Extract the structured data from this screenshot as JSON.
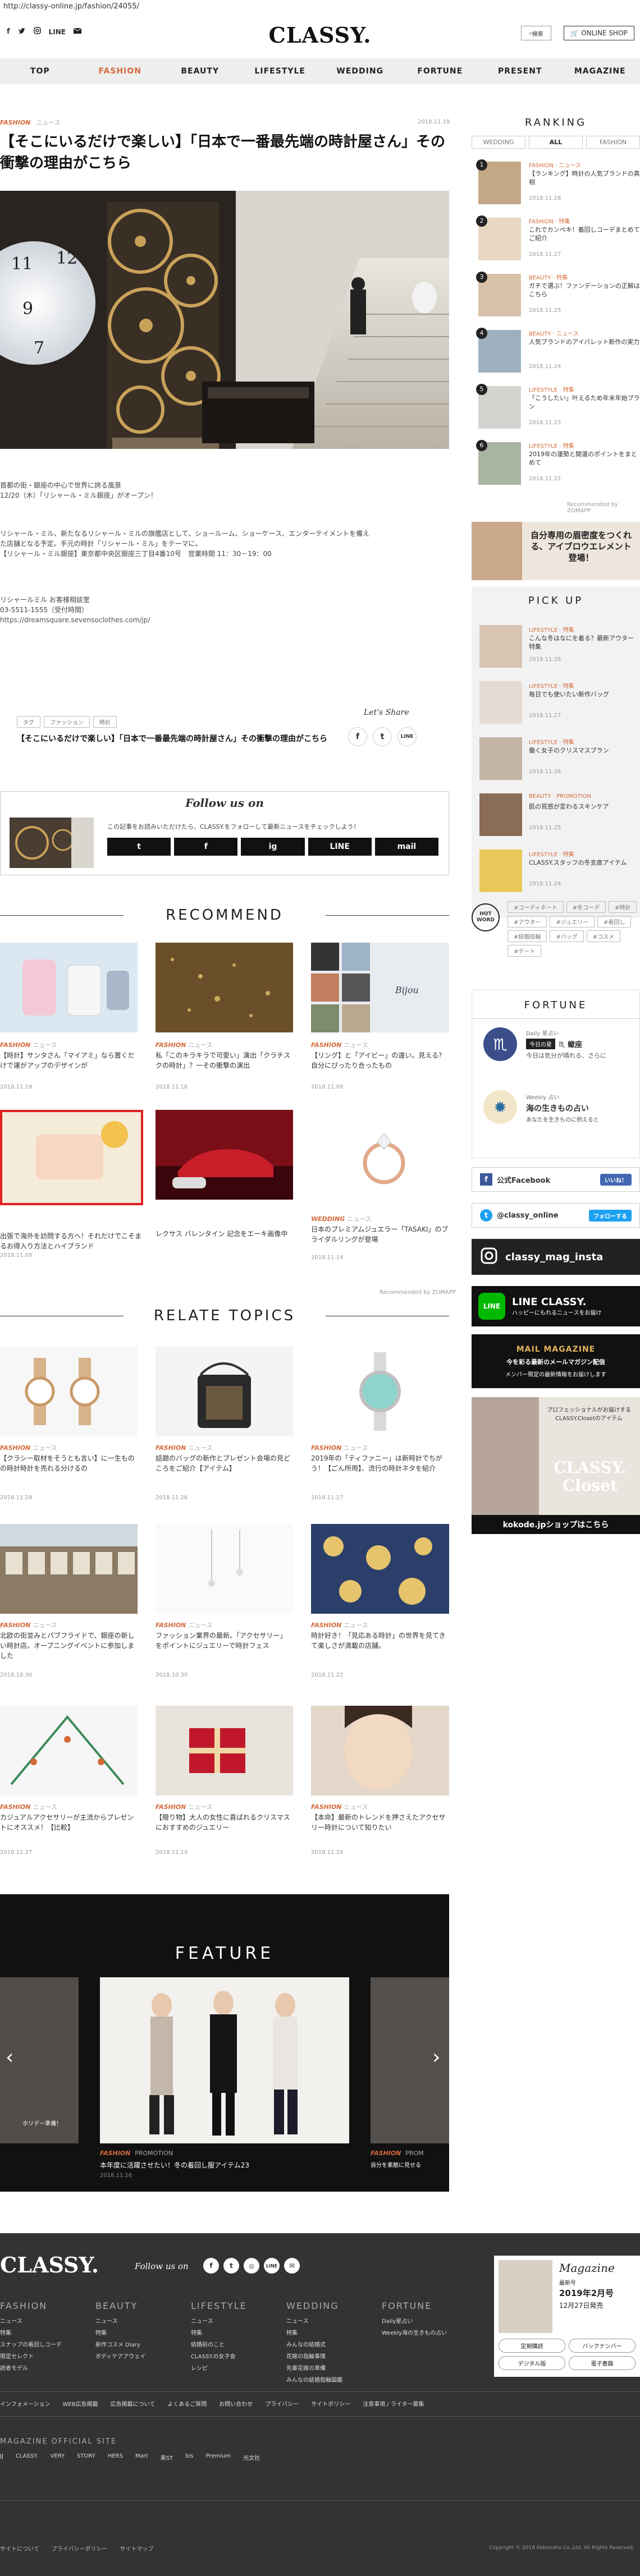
{
  "url": "http://classy-online.jp/fashion/24055/",
  "header": {
    "logo": "CLASSY.",
    "sns": [
      "f",
      "t",
      "ig",
      "LINE",
      "mail"
    ],
    "search_label": "検索",
    "shop_label": "ONLINE SHOP"
  },
  "nav": [
    "TOP",
    "FASHION",
    "BEAUTY",
    "LIFESTYLE",
    "WEDDING",
    "FORTUNE",
    "PRESENT",
    "MAGAZINE"
  ],
  "article": {
    "cat": "FASHION",
    "sub": "ニュース",
    "date": "2018.11.19",
    "title": "【そこにいるだけで楽しい】「日本で一番最先端の時計屋さん」その衝撃の理由がこちら",
    "p1a": "首都の街・銀座の中心で世界に誇る風景",
    "p1b": "12/20（木）「リシャール・ミル銀座」がオープン！",
    "p2a": "リシャール・ミル、新たなるリシャール・ミルの旗艦店として、ショールーム、ショーケース、エンターテイメントを備え",
    "p2b": "た店舗となる予定。手元の時計「リシャール・ミル」をテーマに。",
    "p2c": "【リシャール・ミル銀座】東京都中央区銀座三丁目4番10号　営業時間 11：30－19：00",
    "p3a": "リシャールミル お客様相談室",
    "p3b": "03-5511-1555（受付時間）",
    "p3c": "https://dreamsquare.sevensoclothes.com/jp/",
    "tags": [
      "タグ",
      "ファッション",
      "時計"
    ],
    "share_title": "【そこにいるだけで楽しい】「日本で一番最先端の時計屋さん」その衝撃の理由がこちら",
    "share_label": "Let's Share",
    "share_icons": [
      "f",
      "t",
      "LINE"
    ]
  },
  "follow": {
    "heading": "Follow us on",
    "text": "この記事をお読みいただけたら、CLASSY.をフォローして最新ニュースをチェックしよう！",
    "buttons": [
      "t",
      "f",
      "ig",
      "LINE",
      "mail"
    ]
  },
  "recommend": {
    "heading": "RECOMMEND",
    "items": [
      {
        "cat": "FASHION",
        "sub": "ニュース",
        "title": "【時計】サンタさん「マイアミ」なら置くだけで運がアップのデザインが",
        "date": "2018.11.19"
      },
      {
        "cat": "FASHION",
        "sub": "ニュース",
        "title": "私「このキラキラで可愛い」演出「クラチスクの時計」？一その衝撃の演出",
        "date": "2018.11.16"
      },
      {
        "cat": "FASHION",
        "sub": "ニュース",
        "title": "【リング】と「アイビー」の違い。見える？自分にぴったり合ったもの",
        "date": "2018.11.09"
      },
      {
        "cat": "FASHION",
        "sub": "ニュース",
        "title": "出張で海外を訪問する方へ！それだけでこそまるお得入り方法とハイブランド",
        "date": "2018.11.09"
      },
      {
        "cat": "",
        "sub": "",
        "title": "レクサス バレンタイン 記念をエーキ画像中",
        "date": ""
      },
      {
        "cat": "WEDDING",
        "sub": "ニュース",
        "title": "日本のプレミアムジュエラー「TASAKI」のブライダルリングが登場",
        "date": "2018.11.14"
      }
    ],
    "powered": "Recommended by ZOMAPP"
  },
  "relate": {
    "heading": "RELATE TOPICS",
    "items": [
      {
        "cat": "FASHION",
        "sub": "ニュース",
        "title": "【クラシー取材をそうとも言い】に一生ものの時計時計を売れる分けるの",
        "date": "2018.11.28"
      },
      {
        "cat": "FASHION",
        "sub": "ニュース",
        "title": "話題のバッグの新作とプレゼント会場の見どころをご紹介【アイテム】",
        "date": "2018.11.26"
      },
      {
        "cat": "FASHION",
        "sub": "ニュース",
        "title": "2019年の「ティファニー」は新時計でちがう！【ごん所用】、流行の時計ネタを紹介",
        "date": "2018.11.27"
      },
      {
        "cat": "FASHION",
        "sub": "ニュース",
        "title": "北欧の街並みとパブフライドで、銀座の新しい時計店。オープニングイベントに参加しました",
        "date": "2018.10.30"
      },
      {
        "cat": "FASHION",
        "sub": "ニュース",
        "title": "ファッション業界の最新。「アクセサリー」をポイントにジュエリーで時計フェス",
        "date": "2018.10.30"
      },
      {
        "cat": "FASHION",
        "sub": "ニュース",
        "title": "時計好き！「見応ある時計」の世界を見てきて楽しさが満載の店舗。",
        "date": "2018.11.22"
      },
      {
        "cat": "FASHION",
        "sub": "ニュース",
        "title": "カジュアルアクセサリーが主流からプレゼントにオススメ！【比較】",
        "date": "2018.11.27"
      },
      {
        "cat": "FASHION",
        "sub": "ニュース",
        "title": "【贈り物】大人の女性に喜ばれるクリスマスにおすすめのジュエリー",
        "date": "2018.11.19"
      },
      {
        "cat": "FASHION",
        "sub": "ニュース",
        "title": "【本命】最新のトレンドを押さえたアクセサリー時計について知りたい",
        "date": "2018.11.28"
      }
    ]
  },
  "feature": {
    "heading": "FEATURE",
    "left_caption": "ホリデー準備！",
    "main_cat": "FASHION",
    "main_sub": "PROMOTION",
    "main_title": "本年度に活躍させたい！冬の着回し服アイテム23",
    "main_date": "2018.11.26",
    "right_cat": "FASHION",
    "right_sub": "PROM",
    "right_title": "自分を素敵に見せる"
  },
  "ranking": {
    "heading": "RANKING",
    "tabs": [
      "WEDDING",
      "ALL",
      "FASHION"
    ],
    "items": [
      {
        "rank": "1",
        "cat": "FASHION · ニュース",
        "title": "【ランキング】時計の人気ブランドの真相",
        "date": "2018.11.28"
      },
      {
        "rank": "2",
        "cat": "FASHION · 特集",
        "title": "これでカンペキ！着回しコーデまとめてご紹介",
        "date": "2018.11.27"
      },
      {
        "rank": "3",
        "cat": "BEAUTY · 特集",
        "title": "ガチで選ぶ！ファンデーションの正解はこちら",
        "date": "2018.11.25"
      },
      {
        "rank": "4",
        "cat": "BEAUTY · ニュース",
        "title": "人気ブランドのアイパレット新作の実力",
        "date": "2018.11.24"
      },
      {
        "rank": "5",
        "cat": "LIFESTYLE · 特集",
        "title": "「こうしたい」叶えるため年末年始プラン",
        "date": "2018.11.23"
      },
      {
        "rank": "6",
        "cat": "LIFESTYLE · 特集",
        "title": "2019年の運勢と開運のポイントをまとめて",
        "date": "2018.11.22"
      }
    ],
    "powered": "Recommended by ZOMAPP"
  },
  "ad1": "自分専用の眉密度をつくれる、アイブロウエレメント登場！",
  "pickup": {
    "heading": "PICK UP",
    "items": [
      {
        "cat": "LIFESTYLE · 特集",
        "title": "こんな冬はなにを着る？最新アウター特集",
        "date": "2018.11.28"
      },
      {
        "cat": "LIFESTYLE · 特集",
        "title": "毎日でも使いたい新作バッグ",
        "date": "2018.11.27"
      },
      {
        "cat": "LIFESTYLE · 特集",
        "title": "働く女子のクリスマスプラン",
        "date": "2018.11.26"
      },
      {
        "cat": "BEAUTY · PROMOTION",
        "title": "肌の質感が変わるスキンケア",
        "date": "2018.11.25"
      },
      {
        "cat": "LIFESTYLE · 特集",
        "title": "CLASSY.スタッフの冬支度アイテム",
        "date": "2018.11.24"
      }
    ]
  },
  "hotword": {
    "label": "HOT WORD",
    "words": [
      "#コーディネート",
      "#冬コーデ",
      "#時計",
      "#アウター",
      "#ジュエリー",
      "#着回し",
      "#結婚指輪",
      "#バッグ",
      "#コスメ",
      "#デート"
    ]
  },
  "fortune": {
    "heading": "FORTUNE",
    "daily_label": "Daily 星占い",
    "daily_today": "今日の星",
    "daily_sign": "♏ 蠍座",
    "daily_text": "今日は気分が晴れる、さらに",
    "weekly_label": "Weekly 占い",
    "weekly_text": "海の生きもの占い",
    "weekly_sub": "あなたを生きものに例えると"
  },
  "fb": {
    "label": "公式Facebook",
    "like": "いいね！"
  },
  "tw": {
    "label": "@classy_online",
    "follow": "フォローする"
  },
  "insta": "classy_mag_insta",
  "line": {
    "title": "LINE CLASSY.",
    "sub": "ハッピーにもれるニュースをお届け"
  },
  "mailmag": {
    "title": "MAIL MAGAZINE",
    "sub": "今を彩る最新のメールマガジン配信",
    "text": "メンバー限定の最新情報をお届けします"
  },
  "closet": {
    "text": "プロフェッショナルがお届けするCLASSY.Closetのアイテム",
    "brand": "CLASSY. Closet",
    "foot": "kokode.jpショップはこちら"
  },
  "footer": {
    "logo": "CLASSY.",
    "follow": "Follow us on",
    "cols": [
      {
        "h": "FASHION",
        "items": [
          "ニュース",
          "特集",
          "スナップの着回しコーデ",
          "限定セレクト",
          "読者モデル"
        ]
      },
      {
        "h": "BEAUTY",
        "items": [
          "ニュース",
          "特集",
          "新作コスメ Diary",
          "ボディケアアウェイ"
        ]
      },
      {
        "h": "LIFESTYLE",
        "items": [
          "ニュース",
          "特集",
          "結婚前のこと",
          "CLASSY.の女子会",
          "レシピ"
        ]
      },
      {
        "h": "WEDDING",
        "items": [
          "ニュース",
          "特集",
          "みんなの結婚式",
          "花嫁の指輪事情",
          "先輩花嫁の準備",
          "みんなの結婚指輪図鑑"
        ]
      },
      {
        "h": "FORTUNE",
        "items": [
          "Daily星占い",
          "Weekly海の生きもの占い"
        ]
      }
    ],
    "magazine_label": "Magazine",
    "magazine_sub": "最新号",
    "magazine_date": "2019年2月号",
    "magazine_release": "12月27日発売",
    "mag_btns": [
      "定期購読",
      "バックナンバー",
      "デジタル版",
      "電子書籍"
    ],
    "links": [
      "インフォメーション",
      "WEB広告掲載",
      "広告掲載について",
      "よくあるご質問",
      "お問い合わせ",
      "プライバシー",
      "サイトポリシー",
      "注意事項 / ライター募集"
    ],
    "official_h": "MAGAZINE OFFICIAL SITE",
    "official": [
      "JJ",
      "CLASSY.",
      "VERY",
      "STORY",
      "HERS",
      "Mart",
      "美ST",
      "bis",
      "Premium",
      "光文社"
    ],
    "bottom": [
      "サイトについて",
      "プライバシーポリシー",
      "サイトマップ"
    ],
    "copyright": "Copyright © 2018 Kobunsha Co.,Ltd. All Rights Reserved."
  },
  "colors": {
    "accent": "#d46a3a",
    "dark": "#111111",
    "footer": "#333333"
  }
}
